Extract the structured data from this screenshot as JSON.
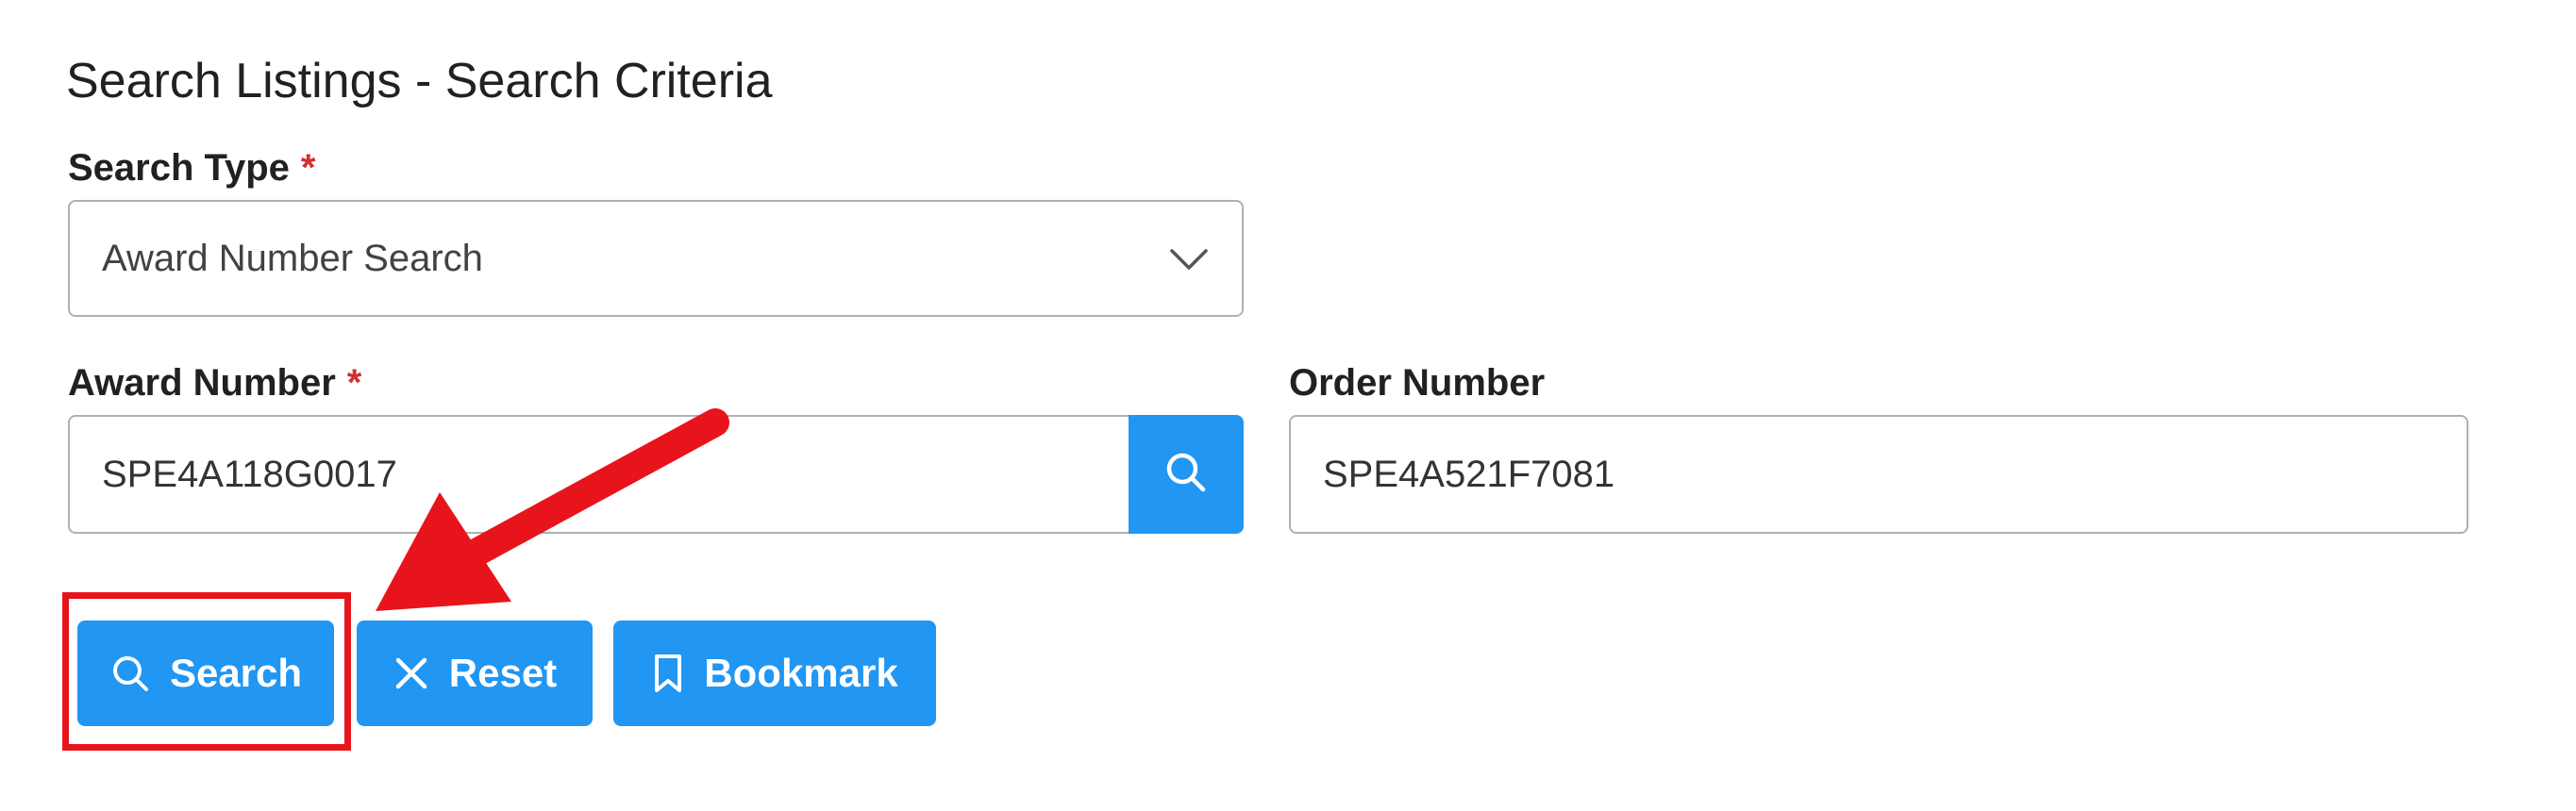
{
  "page": {
    "title": "Search Listings - Search Criteria"
  },
  "search_type": {
    "label": "Search Type",
    "required_mark": "*",
    "selected_value": "Award Number Search",
    "icon": "chevron-down-icon"
  },
  "award_number": {
    "label": "Award Number",
    "required_mark": "*",
    "value": "SPE4A118G0017",
    "lookup_icon": "search-icon"
  },
  "order_number": {
    "label": "Order Number",
    "value": "SPE4A521F7081"
  },
  "actions": {
    "search_label": "Search",
    "search_icon": "search-icon",
    "reset_label": "Reset",
    "reset_icon": "close-icon",
    "bookmark_label": "Bookmark",
    "bookmark_icon": "bookmark-icon"
  },
  "colors": {
    "primary": "#2196f3",
    "required": "#d32f2f",
    "annotation": "#e8141b"
  }
}
